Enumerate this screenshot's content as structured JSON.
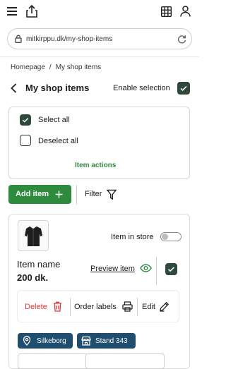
{
  "browser": {
    "url": "mitkirppu.dk/my-shop-items"
  },
  "breadcrumb": {
    "home": "Homepage",
    "separator": "/",
    "current": "My shop items"
  },
  "header": {
    "title": "My shop items",
    "enable_selection_label": "Enable selection",
    "enable_selection_checked": true
  },
  "selection_panel": {
    "select_all_label": "Select all",
    "select_all_checked": true,
    "deselect_all_label": "Deselect all",
    "deselect_all_checked": false,
    "item_actions_label": "Item actions"
  },
  "toolbar": {
    "add_item_label": "Add item",
    "filter_label": "Filter"
  },
  "items": [
    {
      "name": "Item name",
      "price": "200 dk.",
      "in_store_label": "Item in store",
      "in_store_on": false,
      "preview_label": "Preview item",
      "selected": true,
      "actions": {
        "delete_label": "Delete",
        "order_labels_label": "Order labels",
        "edit_label": "Edit"
      },
      "tags": [
        {
          "label": "Silkeborg",
          "icon": "location-pin-icon"
        },
        {
          "label": "Stand 343",
          "icon": "storefront-icon"
        }
      ]
    }
  ],
  "colors": {
    "primary_green": "#2e8b3d",
    "dark_green_check": "#2f4a3a",
    "delete_red": "#d93a3a",
    "chip_blue": "#1f4e6e"
  }
}
